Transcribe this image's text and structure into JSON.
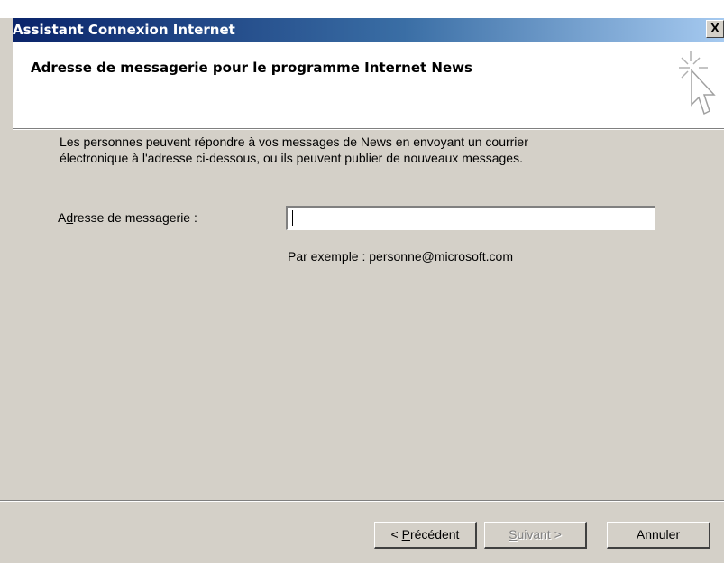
{
  "window": {
    "title": "Assistant Connexion Internet",
    "close_label": "X"
  },
  "header": {
    "title": "Adresse de messagerie pour le programme Internet News",
    "icon": "wizard-cursor-icon"
  },
  "body": {
    "description_line1": "Les personnes peuvent répondre à vos messages de News en envoyant un courrier",
    "description_line2": "électronique à l'adresse ci-dessous, ou ils peuvent publier de nouveaux messages.",
    "email_label_prefix": "A",
    "email_label_mnemonic": "d",
    "email_label_suffix": "resse de messagerie :",
    "email_value": "",
    "example": "Par exemple : personne@microsoft.com"
  },
  "buttons": {
    "back_prefix": "< ",
    "back_mnemonic": "P",
    "back_suffix": "récédent",
    "next_mnemonic": "S",
    "next_suffix": "uivant >",
    "cancel": "Annuler"
  },
  "colors": {
    "dialog_bg": "#d4d0c8",
    "title_bar_start": "#0a246a",
    "title_bar_end": "#a6caf0",
    "disabled_text": "#808080"
  }
}
